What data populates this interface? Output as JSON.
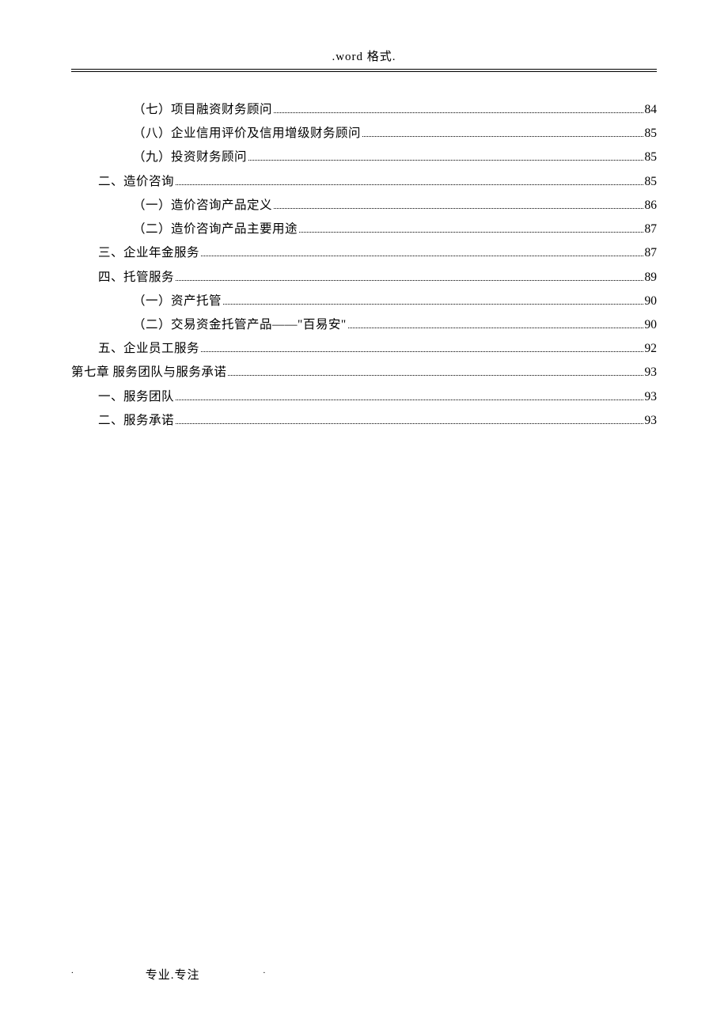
{
  "header": {
    "title": ".word 格式."
  },
  "toc": {
    "entries": [
      {
        "indent": 2,
        "title": "（七）项目融资财务顾问",
        "page": "84"
      },
      {
        "indent": 2,
        "title": "（八）企业信用评价及信用增级财务顾问",
        "page": "85"
      },
      {
        "indent": 2,
        "title": "（九）投资财务顾问",
        "page": "85"
      },
      {
        "indent": 1,
        "title": "二、造价咨询",
        "page": "85"
      },
      {
        "indent": 2,
        "title": "（一）造价咨询产品定义",
        "page": "86"
      },
      {
        "indent": 2,
        "title": "（二）造价咨询产品主要用途",
        "page": "87"
      },
      {
        "indent": 1,
        "title": "三、企业年金服务",
        "page": "87"
      },
      {
        "indent": 1,
        "title": "四、托管服务",
        "page": "89"
      },
      {
        "indent": 2,
        "title": "（一）资产托管",
        "page": "90"
      },
      {
        "indent": 2,
        "title": "（二）交易资金托管产品——\"百易安\"",
        "page": "90"
      },
      {
        "indent": 1,
        "title": "五、企业员工服务",
        "page": "92"
      },
      {
        "indent": 0,
        "title": "第七章  服务团队与服务承诺",
        "page": "93"
      },
      {
        "indent": 1,
        "title": "一、服务团队",
        "page": "93"
      },
      {
        "indent": 1,
        "title": "二、服务承诺",
        "page": "93"
      }
    ]
  },
  "footer": {
    "dot1": ".",
    "text": "专业.专注",
    "dot2": "."
  }
}
